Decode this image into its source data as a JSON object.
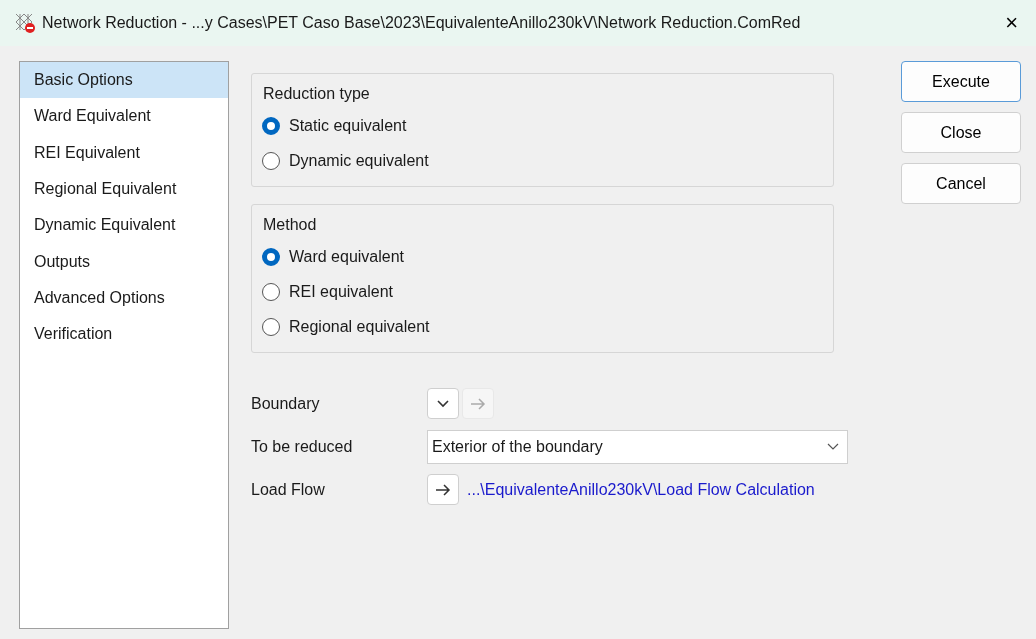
{
  "window": {
    "title": "Network Reduction - ...y Cases\\PET Caso Base\\2023\\EquivalenteAnillo230kV\\Network Reduction.ComRed",
    "close": "×"
  },
  "sidebar": {
    "items": [
      {
        "label": "Basic Options",
        "selected": true
      },
      {
        "label": "Ward Equivalent",
        "selected": false
      },
      {
        "label": "REI Equivalent",
        "selected": false
      },
      {
        "label": "Regional Equivalent",
        "selected": false
      },
      {
        "label": "Dynamic Equivalent",
        "selected": false
      },
      {
        "label": "Outputs",
        "selected": false
      },
      {
        "label": "Advanced Options",
        "selected": false
      },
      {
        "label": "Verification",
        "selected": false
      }
    ]
  },
  "groups": [
    {
      "title": "Reduction type",
      "options": [
        {
          "label": "Static equivalent",
          "selected": true
        },
        {
          "label": "Dynamic equivalent",
          "selected": false
        }
      ]
    },
    {
      "title": "Method",
      "options": [
        {
          "label": "Ward equivalent",
          "selected": true
        },
        {
          "label": "REI equivalent",
          "selected": false
        },
        {
          "label": "Regional equivalent",
          "selected": false
        }
      ]
    }
  ],
  "fields": [
    {
      "kind": "buttons",
      "label": "Boundary",
      "arrow_disabled": true
    },
    {
      "kind": "select",
      "label": "To be reduced",
      "value": "Exterior of the boundary"
    },
    {
      "kind": "link",
      "label": "Load Flow",
      "arrow_disabled": false,
      "link": "...\\EquivalenteAnillo230kV\\Load Flow Calculation"
    }
  ],
  "buttons": [
    {
      "label": "Execute",
      "default": true
    },
    {
      "label": "Close",
      "default": false
    },
    {
      "label": "Cancel",
      "default": false
    }
  ]
}
